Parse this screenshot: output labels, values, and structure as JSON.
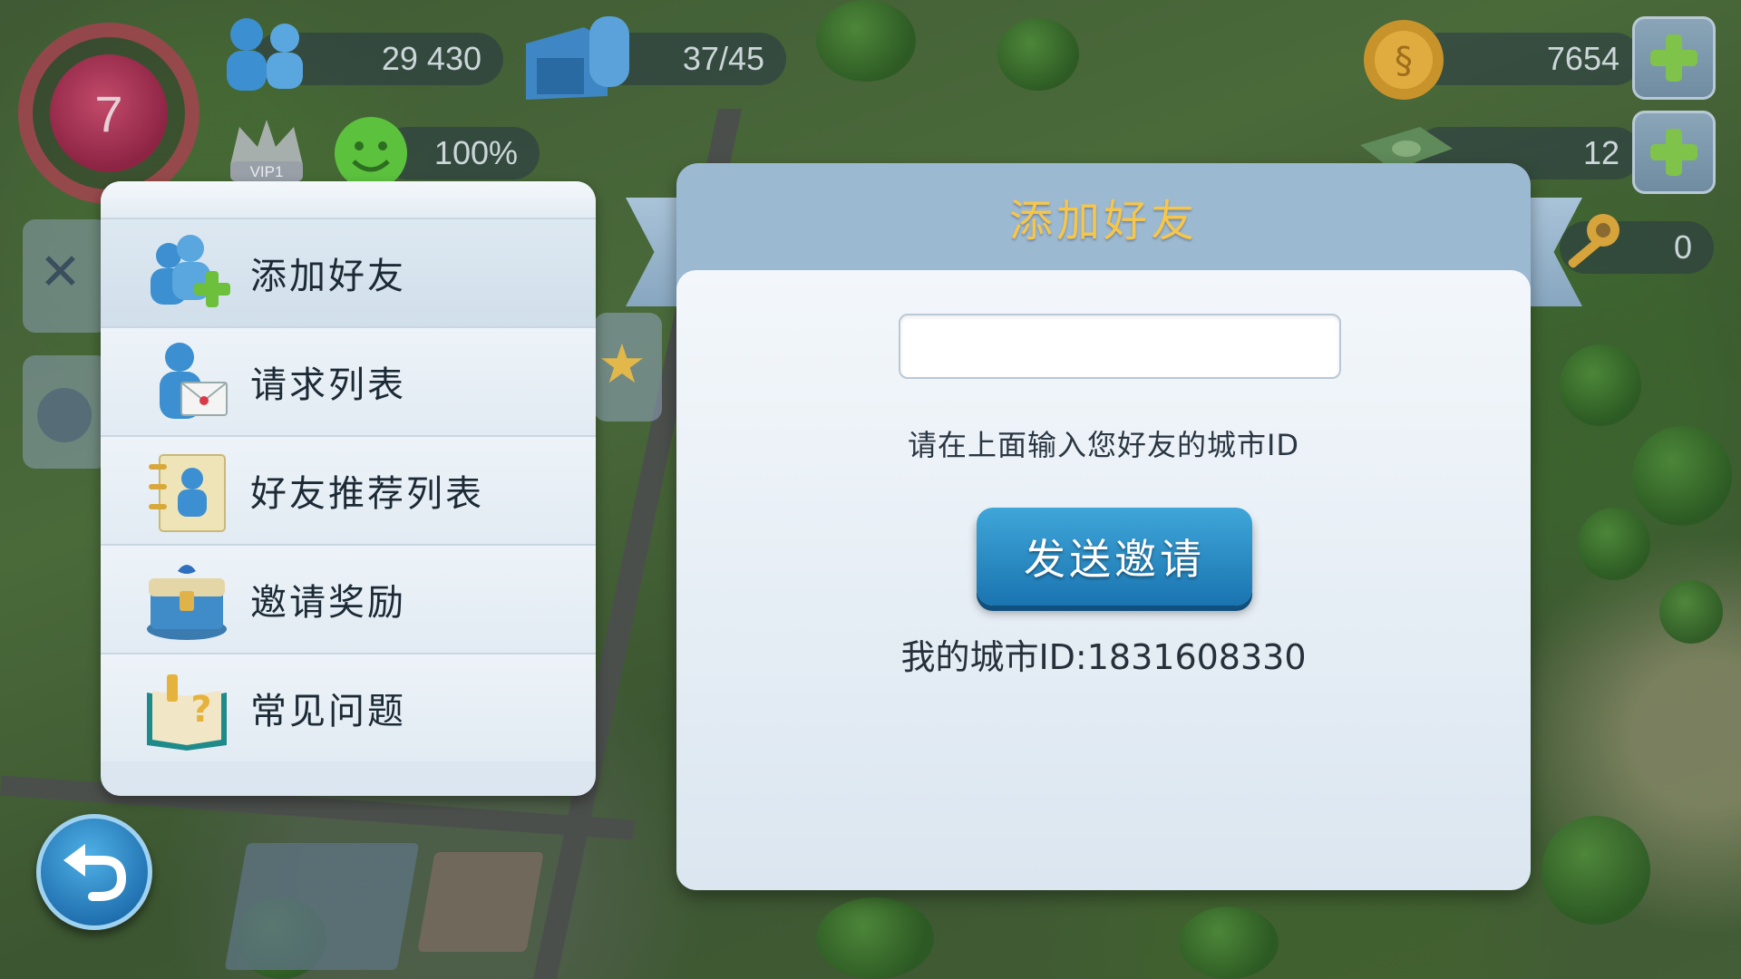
{
  "hud": {
    "level": "7",
    "population": "29 430",
    "storage": "37/45",
    "vip": "VIP1",
    "happiness": "100%",
    "simoleons": "7654",
    "simcash": "12",
    "keys": "0"
  },
  "menu": {
    "items": [
      {
        "label": "添加好友",
        "icon": "add-friend-icon"
      },
      {
        "label": "请求列表",
        "icon": "request-mail-icon"
      },
      {
        "label": "好友推荐列表",
        "icon": "recommend-list-icon"
      },
      {
        "label": "邀请奖励",
        "icon": "gift-chest-icon"
      },
      {
        "label": "常见问题",
        "icon": "faq-book-icon"
      }
    ]
  },
  "dialog": {
    "title": "添加好友",
    "input_value": "",
    "hint": "请在上面输入您好友的城市ID",
    "send_label": "发送邀请",
    "my_city_id": "我的城市ID:1831608330"
  },
  "colors": {
    "title_gold": "#f6c64a",
    "button_blue": "#1a74b0",
    "plus_green": "#7fc34a"
  }
}
